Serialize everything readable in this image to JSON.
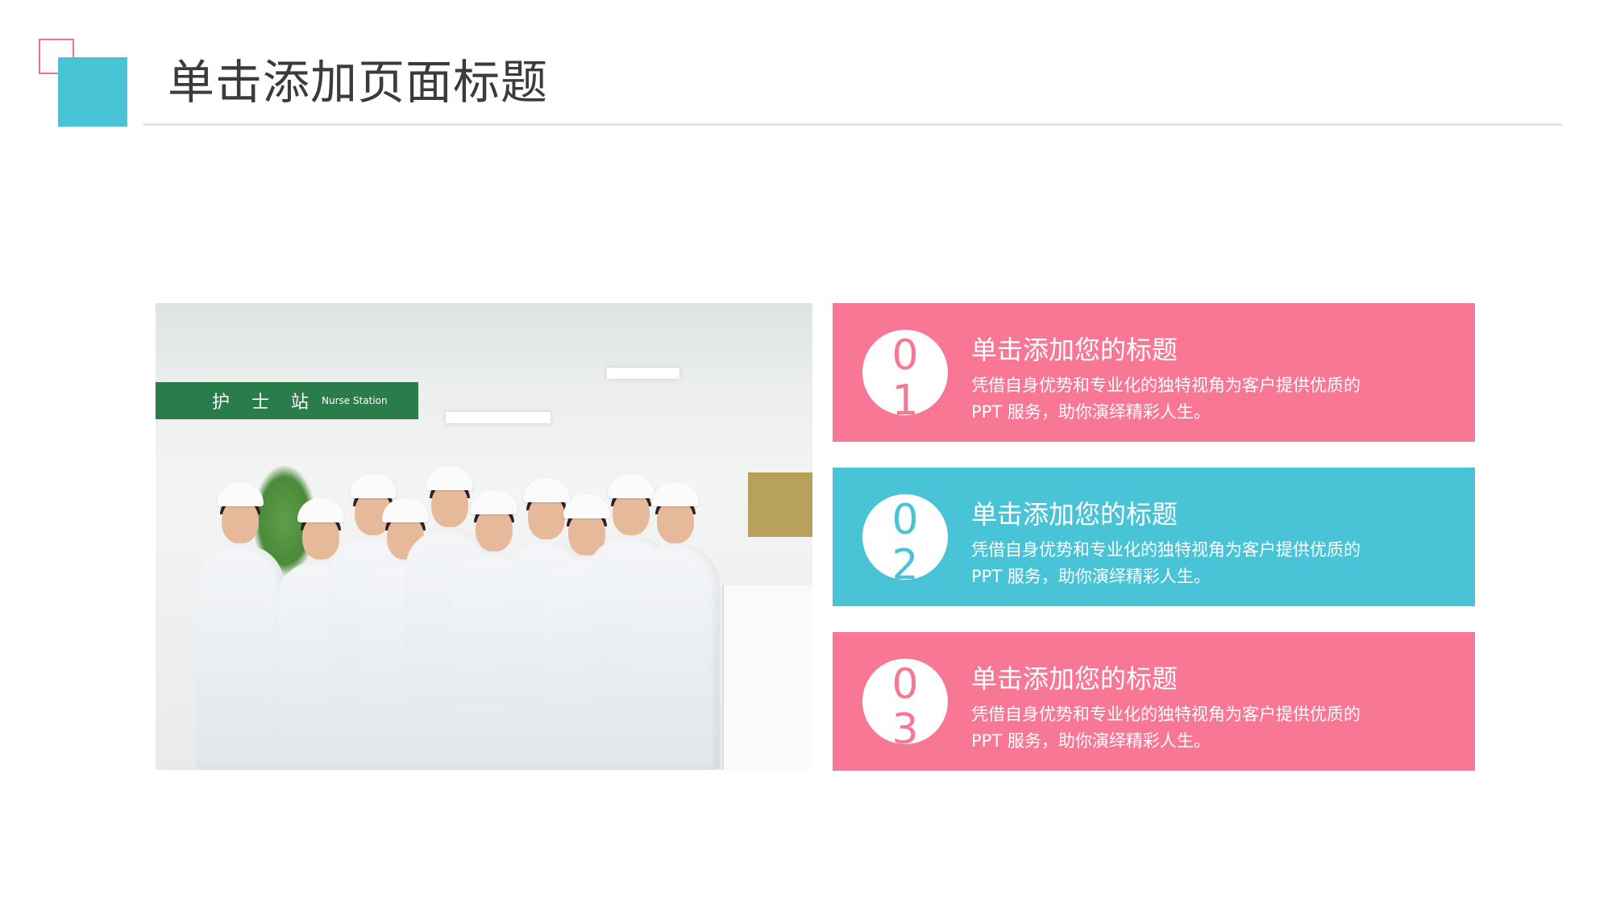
{
  "page": {
    "title": "单击添加页面标题"
  },
  "photo": {
    "sign_text": "护 士 站",
    "sign_subtext": "Nurse Station"
  },
  "colors": {
    "accent_pink": "#f77795",
    "accent_teal": "#49c3d6",
    "title_text": "#3b3b3b"
  },
  "cards": [
    {
      "number": "01",
      "title": "单击添加您的标题",
      "desc_line1": "凭借自身优势和专业化的独特视角为客户提供优质的",
      "desc_line2": "PPT 服务，助你演绎精彩人生。",
      "color": "pink"
    },
    {
      "number": "02",
      "title": "单击添加您的标题",
      "desc_line1": "凭借自身优势和专业化的独特视角为客户提供优质的",
      "desc_line2": "PPT 服务，助你演绎精彩人生。",
      "color": "teal"
    },
    {
      "number": "03",
      "title": "单击添加您的标题",
      "desc_line1": "凭借自身优势和专业化的独特视角为客户提供优质的",
      "desc_line2": "PPT 服务，助你演绎精彩人生。",
      "color": "pink"
    }
  ]
}
